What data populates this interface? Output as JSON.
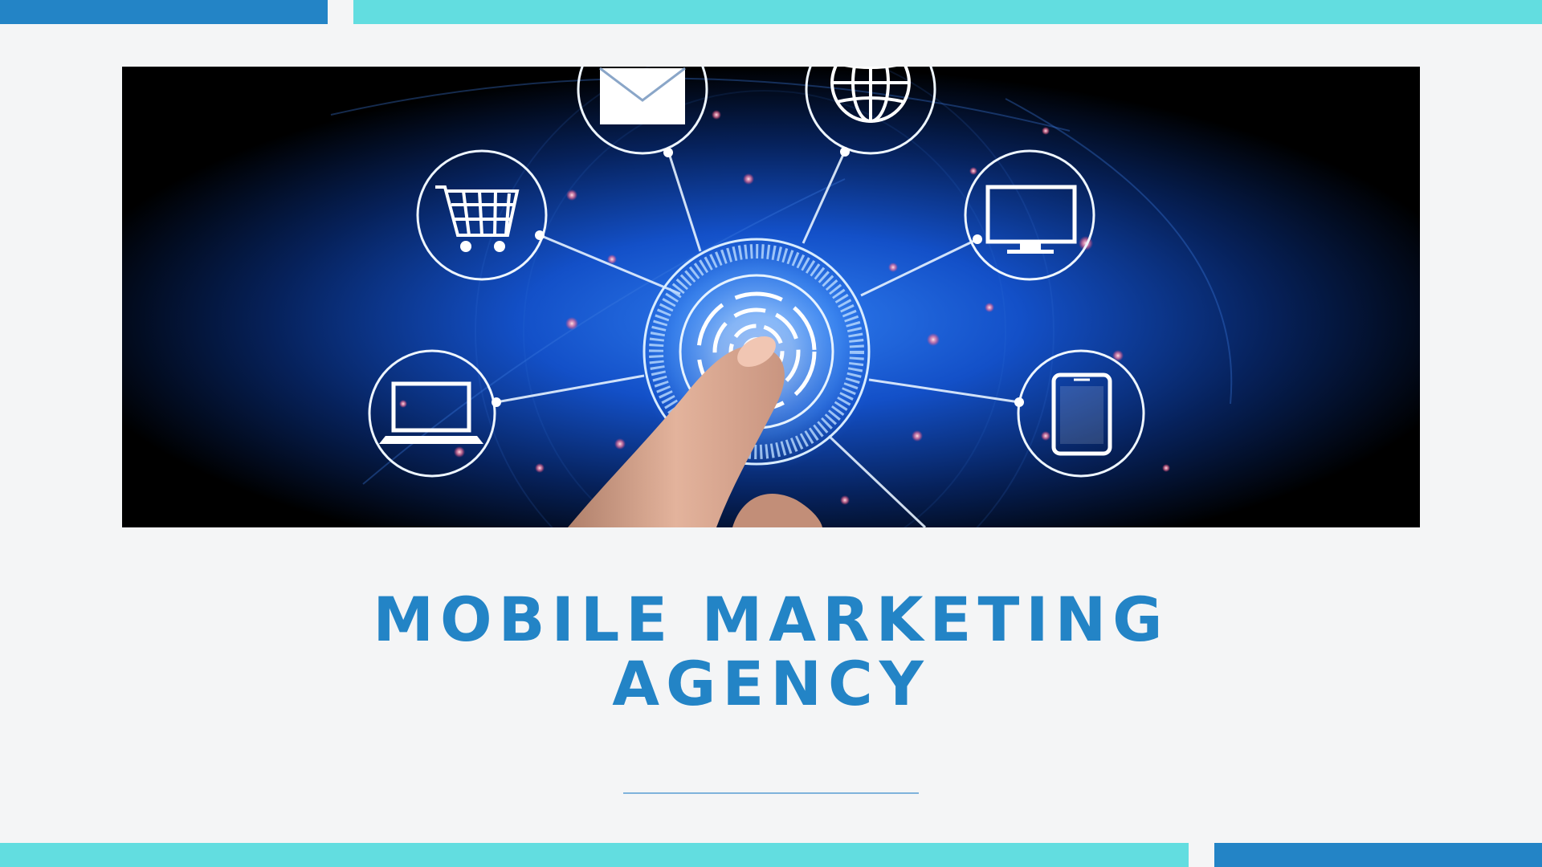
{
  "colors": {
    "background": "#f4f5f6",
    "accent_blue": "#2384c6",
    "accent_cyan": "#62dde0",
    "title": "#2384c6"
  },
  "hero_image": {
    "icons": [
      "envelope-icon",
      "globe-icon",
      "shopping-cart-icon",
      "monitor-icon",
      "laptop-icon",
      "tablet-icon",
      "fingerprint-icon"
    ]
  },
  "title": {
    "line1": "MOBILE MARKETING",
    "line2": "AGENCY"
  }
}
